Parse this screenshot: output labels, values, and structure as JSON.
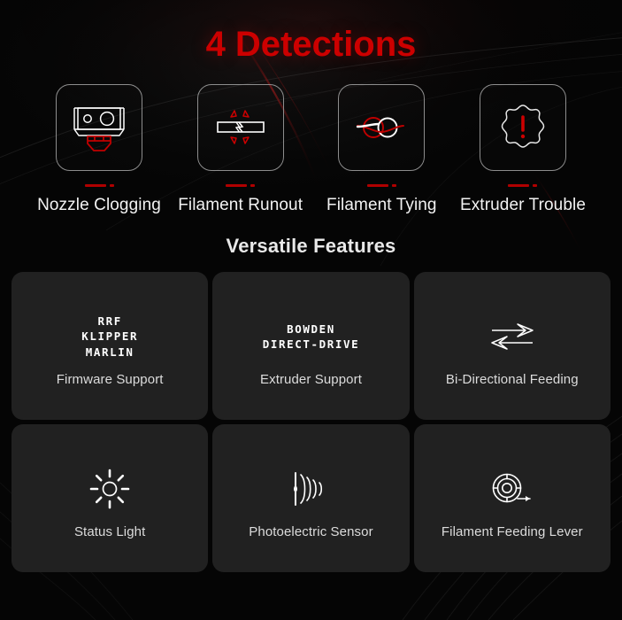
{
  "theme": {
    "background_color": "#050505",
    "accent_red": "#cc0000",
    "card_background": "#212121",
    "text_primary": "#f2f2f2",
    "text_secondary": "#dcdcdc",
    "icon_outline": "#8d8d8d"
  },
  "detections": {
    "title": "4 Detections",
    "items": [
      {
        "label": "Nozzle Clogging",
        "icon": "hotend-nozzle-clog-icon"
      },
      {
        "label": "Filament Runout",
        "icon": "filament-break-icon"
      },
      {
        "label": "Filament Tying",
        "icon": "filament-knot-icon"
      },
      {
        "label": "Extruder Trouble",
        "icon": "gear-alert-icon"
      }
    ]
  },
  "features": {
    "title": "Versatile Features",
    "items": [
      {
        "caption": "Firmware Support",
        "icon": "firmware-text-icon",
        "text_lines": [
          "RRF",
          "KLIPPER",
          "MARLIN"
        ]
      },
      {
        "caption": "Extruder Support",
        "icon": "extruder-text-icon",
        "text_lines": [
          "BOWDEN",
          "DIRECT-DRIVE"
        ]
      },
      {
        "caption": "Bi-Directional Feeding",
        "icon": "bidirectional-arrows-icon",
        "text_lines": []
      },
      {
        "caption": "Status Light",
        "icon": "sun-brightness-icon",
        "text_lines": []
      },
      {
        "caption": "Photoelectric Sensor",
        "icon": "signal-waves-icon",
        "text_lines": []
      },
      {
        "caption": "Filament Feeding Lever",
        "icon": "filament-spool-icon",
        "text_lines": []
      }
    ]
  }
}
